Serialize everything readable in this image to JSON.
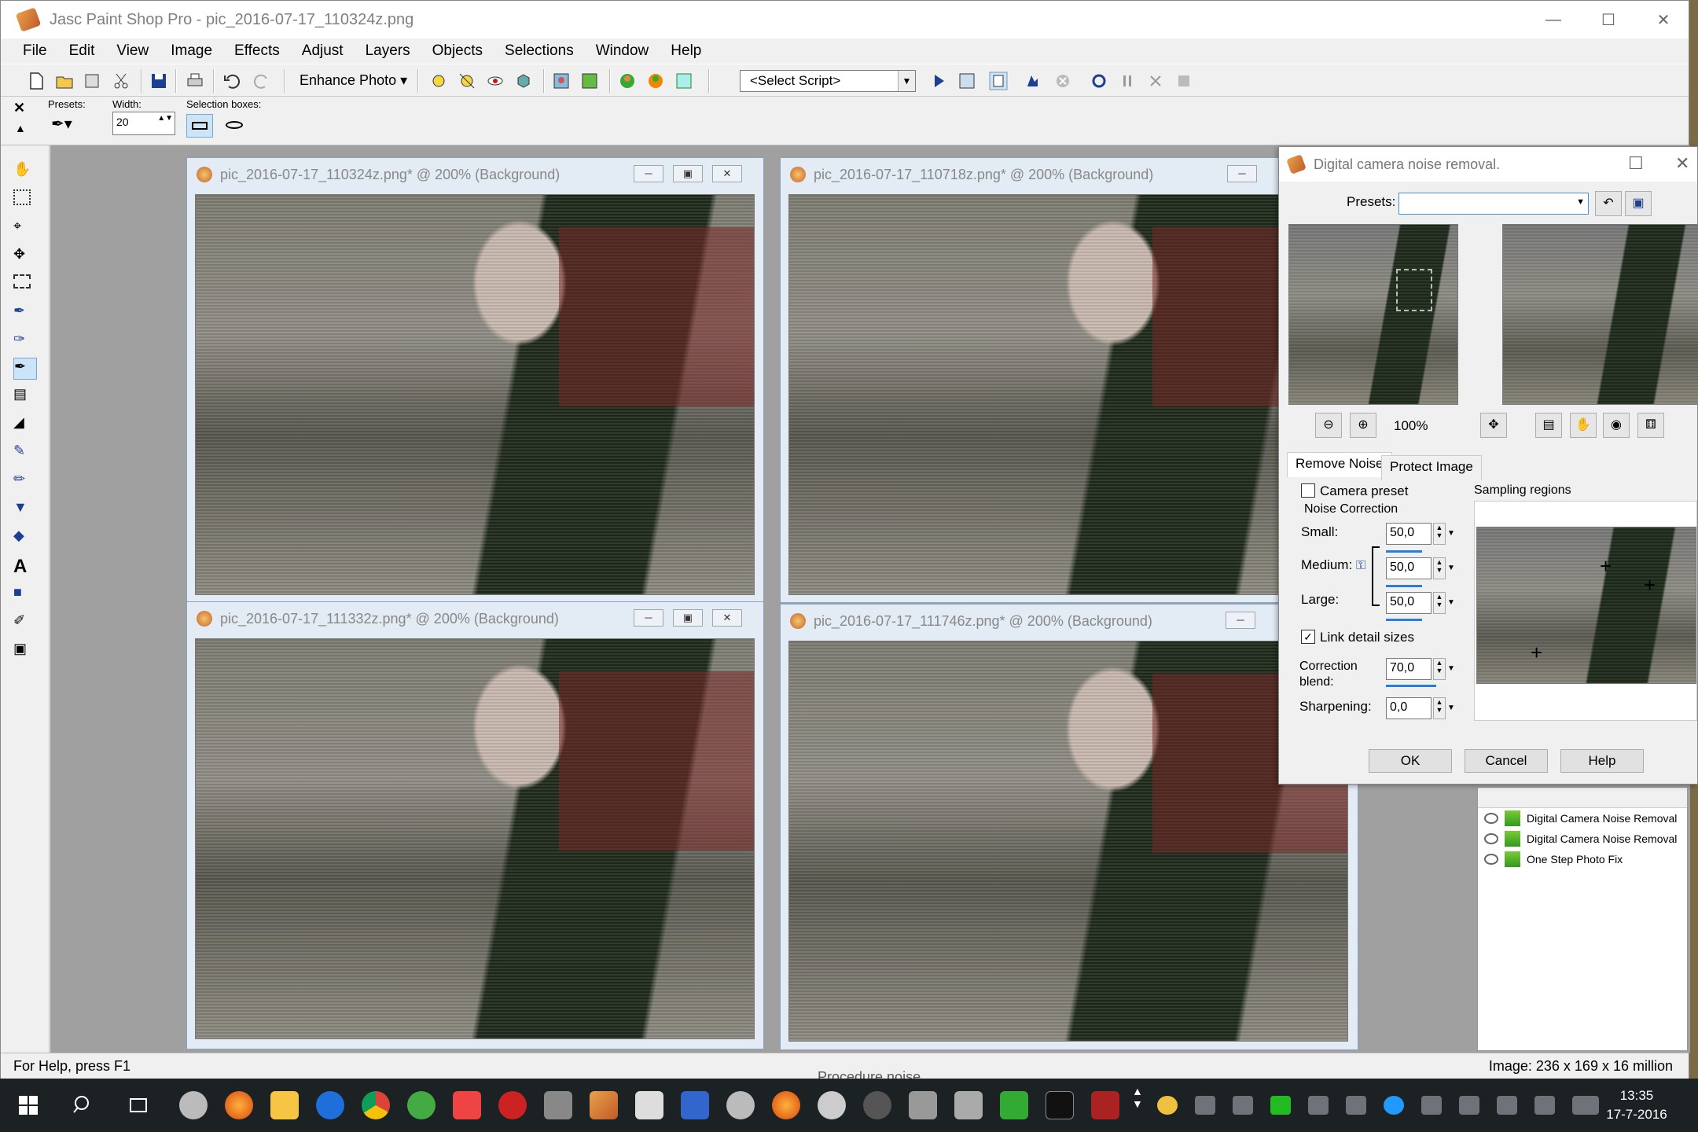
{
  "app": {
    "title": "Jasc Paint Shop Pro - pic_2016-07-17_110324z.png",
    "menus": [
      "File",
      "Edit",
      "View",
      "Image",
      "Effects",
      "Adjust",
      "Layers",
      "Objects",
      "Selections",
      "Window",
      "Help"
    ],
    "enhance_photo": "Enhance Photo",
    "select_script": "<Select Script>",
    "options": {
      "presets_label": "Presets:",
      "width_label": "Width:",
      "width_value": "20",
      "selection_boxes_label": "Selection boxes:"
    },
    "status_left": "For Help, press F1",
    "status_right": "Image:  236 x 169 x 16 million"
  },
  "documents": [
    {
      "title": "pic_2016-07-17_110324z.png* @ 200% (Background)"
    },
    {
      "title": "pic_2016-07-17_110718z.png* @ 200% (Background)"
    },
    {
      "title": "pic_2016-07-17_111332z.png* @ 200% (Background)"
    },
    {
      "title": "pic_2016-07-17_111746z.png* @ 200% (Background)"
    }
  ],
  "dialog": {
    "title": "Digital camera noise removal.",
    "presets_label": "Presets:",
    "presets_value": "",
    "zoom": "100%",
    "tabs": [
      "Remove Noise",
      "Protect Image"
    ],
    "camera_preset": "Camera preset",
    "noise_correction": "Noise Correction",
    "small_label": "Small:",
    "small_value": "50,0",
    "medium_label": "Medium:",
    "medium_value": "50,0",
    "large_label": "Large:",
    "large_value": "50,0",
    "link_detail": "Link detail sizes",
    "correction_blend_label1": "Correction",
    "correction_blend_label2": "blend:",
    "correction_blend_value": "70,0",
    "sharpening_label": "Sharpening:",
    "sharpening_value": "0,0",
    "sampling_regions": "Sampling regions",
    "ok": "OK",
    "cancel": "Cancel",
    "help": "Help"
  },
  "history": [
    "Digital Camera Noise Removal",
    "Digital Camera Noise Removal",
    "One Step Photo Fix"
  ],
  "taskbar": {
    "time": "13:35",
    "date": "17-7-2016",
    "faded_label": "Procedure noise"
  }
}
